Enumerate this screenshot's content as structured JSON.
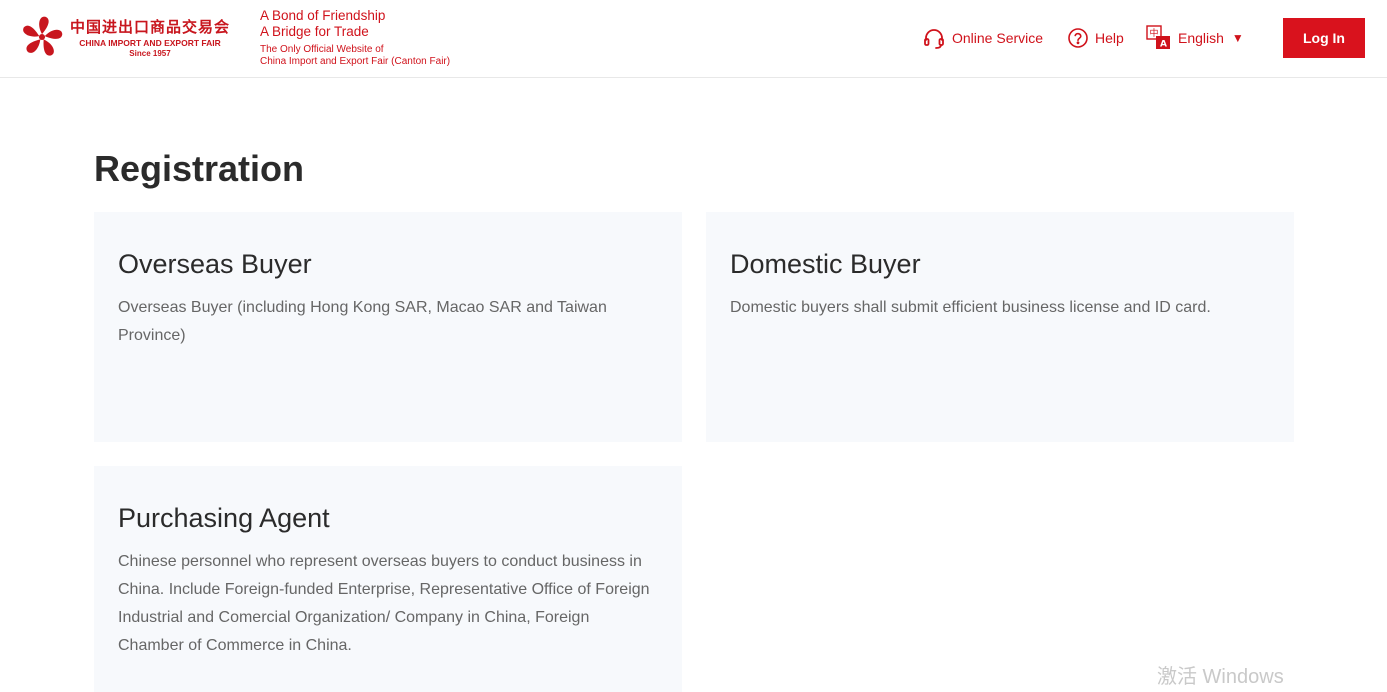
{
  "header": {
    "logo": {
      "cn": "中国进出口商品交易会",
      "en": "CHINA IMPORT AND EXPORT FAIR",
      "since": "Since 1957"
    },
    "slogan": {
      "line1": "A Bond of Friendship",
      "line2": "A Bridge for Trade",
      "sub1": "The Only Official Website of",
      "sub2": "China Import and Export Fair (Canton Fair)"
    },
    "nav": {
      "online_service": "Online Service",
      "help": "Help",
      "language": "English",
      "language_caret": "▼"
    },
    "login_label": "Log In"
  },
  "page": {
    "title": "Registration",
    "cards": [
      {
        "title": "Overseas Buyer",
        "desc": "Overseas Buyer (including Hong Kong SAR, Macao SAR and Taiwan Province)"
      },
      {
        "title": "Domestic Buyer",
        "desc": "Domestic buyers shall submit efficient business license and ID card."
      },
      {
        "title": "Purchasing Agent",
        "desc": "Chinese personnel who represent overseas buyers to conduct business in China. Include Foreign-funded Enterprise, Representative Office of Foreign Industrial and Comercial Organization/ Company in China, Foreign Chamber of Commerce in China."
      }
    ]
  },
  "watermark": "激活 Windows",
  "colors": {
    "brand_red": "#d9121d",
    "card_bg": "#f7f9fc"
  }
}
